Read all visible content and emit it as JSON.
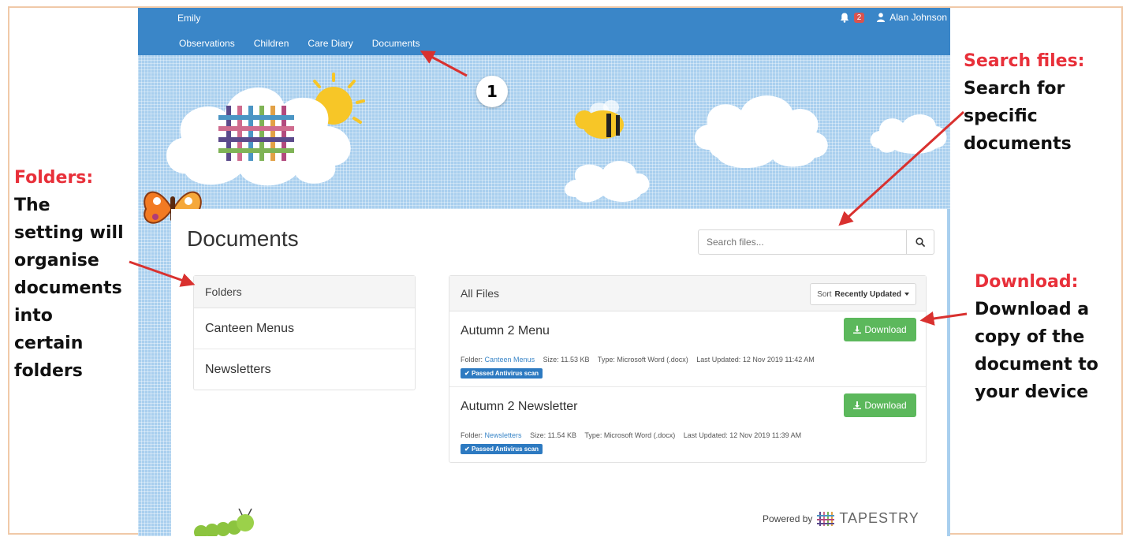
{
  "app": {
    "child_name": "Emily",
    "nav": [
      "Observations",
      "Children",
      "Care Diary",
      "Documents"
    ],
    "notification_count": "2",
    "user_name": "Alan Johnson"
  },
  "page": {
    "title": "Documents",
    "search_placeholder": "Search files..."
  },
  "folders": {
    "header": "Folders",
    "items": [
      "Canteen Menus",
      "Newsletters"
    ]
  },
  "files": {
    "header": "All Files",
    "sort_label": "Sort",
    "sort_value": "Recently Updated",
    "download_label": "Download",
    "folder_label": "Folder:",
    "size_label": "Size:",
    "type_label": "Type:",
    "updated_label": "Last Updated:",
    "items": [
      {
        "name": "Autumn 2 Menu",
        "folder": "Canteen Menus",
        "size": "11.53 KB",
        "type": "Microsoft Word (.docx)",
        "updated": "12 Nov 2019 11:42 AM",
        "scan": "Passed Antivirus scan"
      },
      {
        "name": "Autumn 2 Newsletter",
        "folder": "Newsletters",
        "size": "11.54 KB",
        "type": "Microsoft Word (.docx)",
        "updated": "12 Nov 2019 11:39 AM",
        "scan": "Passed Antivirus scan"
      }
    ]
  },
  "footer": {
    "powered_by": "Powered by",
    "brand": "TAPESTRY"
  },
  "annotations": {
    "marker": "1",
    "folders": {
      "heading": "Folders:",
      "body": [
        "The",
        "setting will",
        "organise",
        "documents",
        "into",
        "certain",
        "folders"
      ]
    },
    "search": {
      "heading": "Search files:",
      "body": [
        "Search for",
        "specific",
        "documents"
      ]
    },
    "download": {
      "heading": "Download:",
      "body": [
        "Download a",
        "copy of the",
        "document to",
        "your device"
      ]
    }
  },
  "colors": {
    "nav_bar": "#3a86c8",
    "download_button": "#5cb85c",
    "annotation_heading": "#e8303a",
    "scan_badge": "#2d7ac1"
  }
}
